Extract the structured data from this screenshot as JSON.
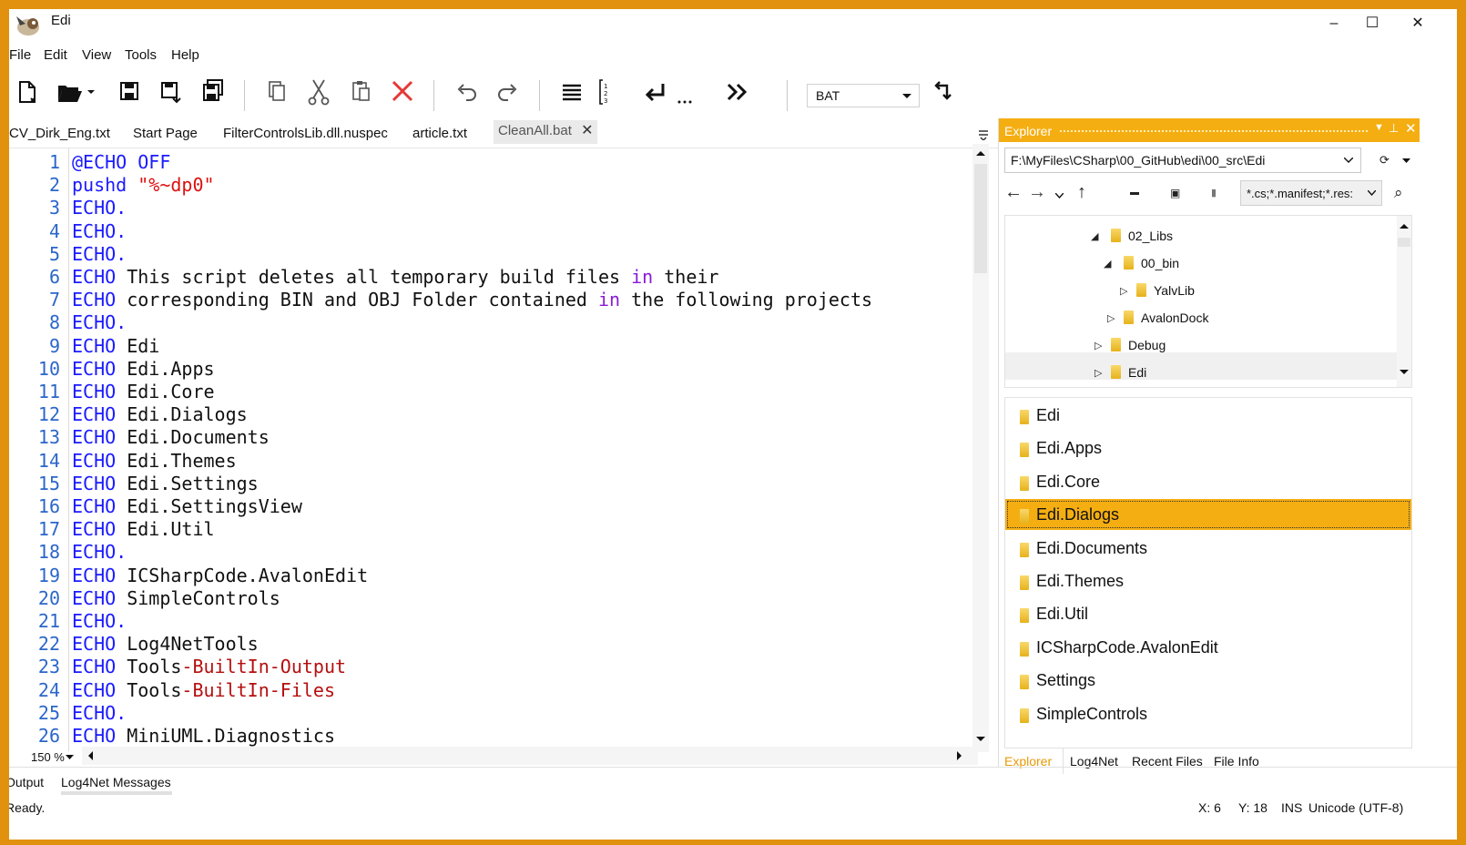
{
  "window": {
    "title": "Edi",
    "minimize": "–",
    "maximize": "☐",
    "close": "✕"
  },
  "menu": [
    {
      "label": "File"
    },
    {
      "label": "Edit"
    },
    {
      "label": "View"
    },
    {
      "label": "Tools"
    },
    {
      "label": "Help"
    }
  ],
  "toolbar": {
    "icons": [
      "new-file-icon",
      "open-folder-icon",
      "open-dropdown-icon",
      "save-icon",
      "save-as-icon",
      "save-all-icon",
      "copy-icon",
      "cut-icon",
      "paste-icon",
      "delete-icon",
      "undo-icon",
      "redo-icon",
      "word-wrap-icon",
      "line-numbers-icon",
      "newline-icon",
      "ellipsis-icon",
      "fast-forward-icon",
      "settings-icon"
    ],
    "highlighting": "BAT"
  },
  "doc_tabs": [
    {
      "label": "CV_Dirk_Eng.txt"
    },
    {
      "label": "Start Page"
    },
    {
      "label": "FilterControlsLib.dll.nuspec"
    },
    {
      "label": "article.txt"
    },
    {
      "label": "CleanAll.bat",
      "active": true
    }
  ],
  "editor": {
    "lines": [
      {
        "n": "1",
        "parts": [
          {
            "c": "kw",
            "t": "@ECHO OFF"
          }
        ]
      },
      {
        "n": "2",
        "parts": [
          {
            "c": "kw",
            "t": "pushd "
          },
          {
            "c": "str",
            "t": "\"%~dp0\""
          }
        ]
      },
      {
        "n": "3",
        "parts": [
          {
            "c": "kw",
            "t": "ECHO."
          }
        ]
      },
      {
        "n": "4",
        "parts": [
          {
            "c": "kw",
            "t": "ECHO."
          }
        ]
      },
      {
        "n": "5",
        "parts": [
          {
            "c": "kw",
            "t": "ECHO."
          }
        ]
      },
      {
        "n": "6",
        "parts": [
          {
            "c": "kw",
            "t": "ECHO"
          },
          {
            "c": "",
            "t": " This script deletes all temporary build files "
          },
          {
            "c": "kw2",
            "t": "in"
          },
          {
            "c": "",
            "t": " their"
          }
        ]
      },
      {
        "n": "7",
        "parts": [
          {
            "c": "kw",
            "t": "ECHO"
          },
          {
            "c": "",
            "t": " corresponding BIN and OBJ Folder contained "
          },
          {
            "c": "kw2",
            "t": "in"
          },
          {
            "c": "",
            "t": " the following projects"
          }
        ]
      },
      {
        "n": "8",
        "parts": [
          {
            "c": "kw",
            "t": "ECHO."
          }
        ]
      },
      {
        "n": "9",
        "parts": [
          {
            "c": "kw",
            "t": "ECHO"
          },
          {
            "c": "",
            "t": " Edi"
          }
        ]
      },
      {
        "n": "10",
        "parts": [
          {
            "c": "kw",
            "t": "ECHO"
          },
          {
            "c": "",
            "t": " Edi.Apps"
          }
        ]
      },
      {
        "n": "11",
        "parts": [
          {
            "c": "kw",
            "t": "ECHO"
          },
          {
            "c": "",
            "t": " Edi.Core"
          }
        ]
      },
      {
        "n": "12",
        "parts": [
          {
            "c": "kw",
            "t": "ECHO"
          },
          {
            "c": "",
            "t": " Edi.Dialogs"
          }
        ]
      },
      {
        "n": "13",
        "parts": [
          {
            "c": "kw",
            "t": "ECHO"
          },
          {
            "c": "",
            "t": " Edi.Documents"
          }
        ]
      },
      {
        "n": "14",
        "parts": [
          {
            "c": "kw",
            "t": "ECHO"
          },
          {
            "c": "",
            "t": " Edi.Themes"
          }
        ]
      },
      {
        "n": "15",
        "parts": [
          {
            "c": "kw",
            "t": "ECHO"
          },
          {
            "c": "",
            "t": " Edi.Settings"
          }
        ]
      },
      {
        "n": "16",
        "parts": [
          {
            "c": "kw",
            "t": "ECHO"
          },
          {
            "c": "",
            "t": " Edi.SettingsView"
          }
        ]
      },
      {
        "n": "17",
        "parts": [
          {
            "c": "kw",
            "t": "ECHO"
          },
          {
            "c": "",
            "t": " Edi.Util"
          }
        ]
      },
      {
        "n": "18",
        "parts": [
          {
            "c": "kw",
            "t": "ECHO."
          }
        ]
      },
      {
        "n": "19",
        "parts": [
          {
            "c": "kw",
            "t": "ECHO"
          },
          {
            "c": "",
            "t": " ICSharpCode.AvalonEdit"
          }
        ]
      },
      {
        "n": "20",
        "parts": [
          {
            "c": "kw",
            "t": "ECHO"
          },
          {
            "c": "",
            "t": " SimpleControls"
          }
        ]
      },
      {
        "n": "21",
        "parts": [
          {
            "c": "kw",
            "t": "ECHO."
          }
        ]
      },
      {
        "n": "22",
        "parts": [
          {
            "c": "kw",
            "t": "ECHO"
          },
          {
            "c": "",
            "t": " Log4NetTools"
          }
        ]
      },
      {
        "n": "23",
        "parts": [
          {
            "c": "kw",
            "t": "ECHO"
          },
          {
            "c": "",
            "t": " Tools"
          },
          {
            "c": "opt",
            "t": "-BuiltIn-Output"
          }
        ]
      },
      {
        "n": "24",
        "parts": [
          {
            "c": "kw",
            "t": "ECHO"
          },
          {
            "c": "",
            "t": " Tools"
          },
          {
            "c": "opt",
            "t": "-BuiltIn-Files"
          }
        ]
      },
      {
        "n": "25",
        "parts": [
          {
            "c": "kw",
            "t": "ECHO."
          }
        ]
      },
      {
        "n": "26",
        "parts": [
          {
            "c": "kw",
            "t": "ECHO"
          },
          {
            "c": "",
            "t": " MiniUML.Diagnostics"
          }
        ]
      }
    ],
    "zoom": "150 %"
  },
  "explorer": {
    "title": "Explorer",
    "path": "F:\\MyFiles\\CSharp\\00_GitHub\\edi\\00_src\\Edi",
    "filter": "*.cs;*.manifest;*.res:",
    "tree": [
      {
        "label": "02_Libs",
        "expanded": true
      },
      {
        "label": "00_bin",
        "expanded": true
      },
      {
        "label": "YalvLib",
        "expanded": false
      },
      {
        "label": "AvalonDock",
        "expanded": false
      },
      {
        "label": "Debug",
        "expanded": false
      },
      {
        "label": "Edi",
        "expanded": false
      }
    ],
    "folders": [
      {
        "label": "Edi"
      },
      {
        "label": "Edi.Apps"
      },
      {
        "label": "Edi.Core"
      },
      {
        "label": "Edi.Dialogs",
        "selected": true
      },
      {
        "label": "Edi.Documents"
      },
      {
        "label": "Edi.Themes"
      },
      {
        "label": "Edi.Util"
      },
      {
        "label": "ICSharpCode.AvalonEdit"
      },
      {
        "label": "Settings"
      },
      {
        "label": "SimpleControls"
      }
    ],
    "tabs": [
      {
        "label": "Explorer",
        "active": true
      },
      {
        "label": "Log4Net"
      },
      {
        "label": "Recent Files"
      },
      {
        "label": "File Info"
      }
    ]
  },
  "bottom_tabs": [
    {
      "label": "Output"
    },
    {
      "label": "Log4Net Messages"
    }
  ],
  "status": {
    "text": "Ready.",
    "x": "X: 6",
    "y": "Y: 18",
    "mode": "INS",
    "encoding": "Unicode (UTF-8)"
  },
  "colors": {
    "accent": "#f5ae12",
    "frame": "#e2910f",
    "keyword": "#1a1aff",
    "string": "#dd1111"
  }
}
